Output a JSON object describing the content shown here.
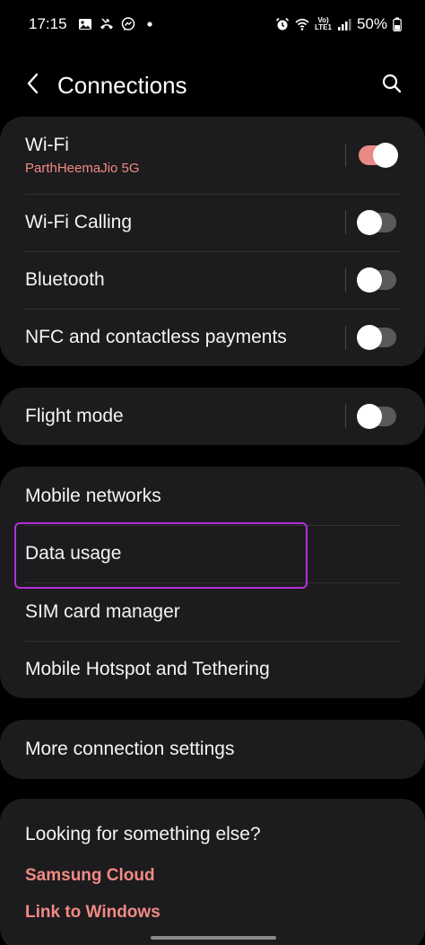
{
  "status_bar": {
    "time": "17:15",
    "lte_top": "Vo)",
    "lte_bottom": "LTE1",
    "battery": "50%",
    "icons_left": [
      "gallery-icon",
      "missed-call-icon",
      "messenger-icon",
      "dot-icon"
    ],
    "icons_right": [
      "alarm-icon",
      "wifi-icon",
      "signal-icon",
      "battery-icon"
    ]
  },
  "header": {
    "title": "Connections",
    "back_icon": "chevron-left-icon",
    "search_icon": "search-icon"
  },
  "groups": [
    {
      "items": [
        {
          "label": "Wi-Fi",
          "sublabel": "ParthHeemaJio 5G",
          "toggle": true
        },
        {
          "label": "Wi-Fi Calling",
          "toggle": false
        },
        {
          "label": "Bluetooth",
          "toggle": false
        },
        {
          "label": "NFC and contactless payments",
          "toggle": false
        }
      ]
    },
    {
      "items": [
        {
          "label": "Flight mode",
          "toggle": false
        }
      ]
    },
    {
      "items": [
        {
          "label": "Mobile networks"
        },
        {
          "label": "Data usage",
          "highlighted": true
        },
        {
          "label": "SIM card manager"
        },
        {
          "label": "Mobile Hotspot and Tethering"
        }
      ]
    },
    {
      "items": [
        {
          "label": "More connection settings"
        }
      ]
    }
  ],
  "footer": {
    "title": "Looking for something else?",
    "links": [
      "Samsung Cloud",
      "Link to Windows"
    ]
  },
  "colors": {
    "background": "#000000",
    "card": "#1c1b1d",
    "accent": "#f08a84",
    "toggle_on": "#e98a86",
    "toggle_off": "#5a595c",
    "highlight": "#b32fd9"
  }
}
